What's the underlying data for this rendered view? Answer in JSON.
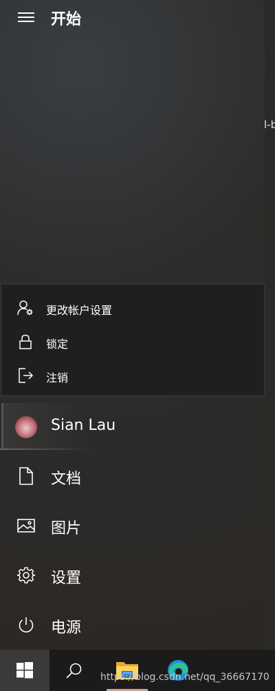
{
  "start_menu": {
    "title": "开始",
    "user_name": "Sian Lau"
  },
  "account_menu": {
    "items": [
      {
        "label": "更改帐户设置",
        "icon": "account-settings-icon"
      },
      {
        "label": "锁定",
        "icon": "lock-icon"
      },
      {
        "label": "注销",
        "icon": "sign-out-icon"
      }
    ]
  },
  "nav": {
    "items": [
      {
        "label": "文档",
        "icon": "document-icon"
      },
      {
        "label": "图片",
        "icon": "picture-icon"
      },
      {
        "label": "设置",
        "icon": "gear-icon"
      },
      {
        "label": "电源",
        "icon": "power-icon"
      }
    ]
  },
  "background_fragment": "l-b",
  "watermark": "https://blog.csdn.net/qq_36667170",
  "taskbar": {
    "items": [
      "windows-start-icon",
      "search-icon",
      "file-explorer-icon",
      "edge-icon"
    ]
  }
}
